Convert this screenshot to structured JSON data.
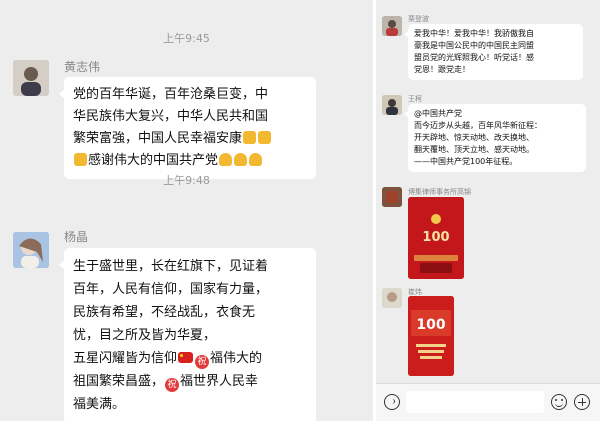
{
  "left_chat": {
    "time_1": "上午9:45",
    "time_2": "上午9:48",
    "message_1": {
      "sender": "黄志伟",
      "lines": [
        "党的百年华诞，百年沧桑巨变，中",
        "华民族伟大复兴，中华人民共和国",
        "繁荣富強，中国人民幸福安康",
        "感谢伟大的中国共产党"
      ]
    },
    "message_2": {
      "sender": "杨晶",
      "lines": [
        "生于盛世里，长在红旗下，见证着",
        "百年，人民有信仰，国家有力量，",
        "民族有希望，不经战乱，衣食无",
        "忧，目之所及皆为华夏，",
        "五星闪耀皆为信仰",
        "福伟大的",
        "祖国繁荣昌盛，",
        "福世界人民幸",
        "福美满。"
      ],
      "zhu_label": "祝"
    }
  },
  "right_chat": {
    "message_1": {
      "sender": "栗登波",
      "lines": [
        "爱我中华！爱我中华！我骄傲我自",
        "豪我是中国公民中的中国民主同盟",
        "盟员党的光辉照我心！听党话！感",
        "党恩！跟党走！"
      ]
    },
    "message_2": {
      "sender": "王柯",
      "lines": [
        "@中国共产党",
        "而今迈步从头越，百年风华新征程：",
        "开天辟地、惊天动地、改天换地、",
        "翻天覆地、顶天立地、感天动地。",
        "——中国共产党100年征程。"
      ]
    },
    "message_3": {
      "sender": "博集律师事务所高锦",
      "image_text": "100"
    },
    "message_4": {
      "sender": "崔炜",
      "image_text": "100"
    }
  },
  "colors": {
    "chat_bg": "#ededed",
    "bubble": "#ffffff",
    "party_red": "#c3171b",
    "gold": "#f2b830"
  }
}
